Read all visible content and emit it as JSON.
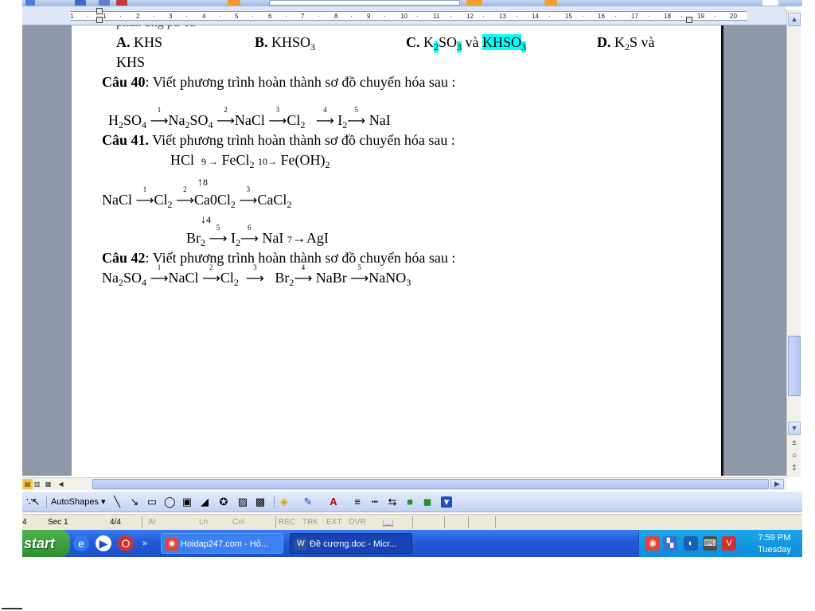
{
  "ruler": {
    "labels": [
      "1",
      "·",
      "1",
      "·",
      "2",
      "·",
      "3",
      "·",
      "4",
      "·",
      "5",
      "·",
      "6",
      "·",
      "7",
      "·",
      "8",
      "·",
      "9",
      "·",
      "10",
      "·",
      "11",
      "·",
      "12",
      "·",
      "13",
      "·",
      "14",
      "·",
      "15",
      "·",
      "16",
      "·",
      "17",
      "·",
      "18",
      "·",
      "19",
      "·",
      "20"
    ]
  },
  "document": {
    "options_line": {
      "a_label": "A.",
      "a_text": "KHS",
      "b_label": "B.",
      "b_text": "KHSO",
      "c_label": "C.",
      "c_text_1": "K",
      "c_text_2": "SO",
      "c_and": "và",
      "c_text_3": "KHSO",
      "d_label": "D.",
      "d_text": "K",
      "d_text_2": "S và",
      "wrap": "KHS"
    },
    "q40": {
      "label": "Câu 40",
      "text": ": Viết phương trình hoàn thành sơ đồ chuyển hóa sau :",
      "chain": [
        "H",
        "SO",
        "Na",
        "SO",
        "NaCl",
        "Cl",
        "I",
        "NaI"
      ],
      "steps": [
        "1",
        "2",
        "3",
        "4",
        "5"
      ]
    },
    "q41": {
      "label": "Câu 41.",
      "text": "Viết phương trình hoàn thành sơ đồ chuyển hóa sau :",
      "top_row": {
        "hcl": "HCl",
        "s9": "9",
        "fecl": "FeCl",
        "s10": "10",
        "feoh": "Fe(OH)"
      },
      "up_label": "8",
      "main_row": {
        "nacl": "NaCl",
        "cl": "Cl",
        "ca0cl": "Ca0Cl",
        "cacl": "CaCl",
        "s1": "1",
        "s2": "2",
        "s3": "3"
      },
      "down_label": "4",
      "bottom_row": {
        "br": "Br",
        "i": "I",
        "nai": "NaI",
        "agi": "AgI",
        "s5": "5",
        "s6": "6",
        "s7": "7"
      }
    },
    "q42": {
      "label": "Câu 42",
      "text": ": Viết phương trình hoàn thành sơ đồ chuyển hóa sau :",
      "chain": {
        "na2so4_a": "Na",
        "na2so4_b": "SO",
        "nacl": "NaCl",
        "cl": "Cl",
        "br": "Br",
        "nabr": "NaBr",
        "nano": "NaNO"
      },
      "steps": [
        "1",
        "2",
        "3",
        "4",
        "5"
      ]
    }
  },
  "draw_toolbar": {
    "autoshapes": "AutoShapes ▾"
  },
  "status_bar": {
    "page_idx": "4",
    "sec": "Sec  1",
    "page_count": "4/4",
    "at": "At",
    "ln": "Ln",
    "col": "Col",
    "rec": "REC",
    "trk": "TRK",
    "ext": "EXT",
    "ovr": "OVR"
  },
  "taskbar": {
    "start": "start",
    "task1": "Hoidap247.com - Hỏ...",
    "task2": "Đề cương.doc - Micr...",
    "time": "7:59 PM",
    "day": "Tuesday"
  },
  "colors": {
    "highlight": "#00ffff",
    "taskbar": "#2459d8",
    "tray": "#0d8bd9",
    "start": "#2f8f2f"
  }
}
